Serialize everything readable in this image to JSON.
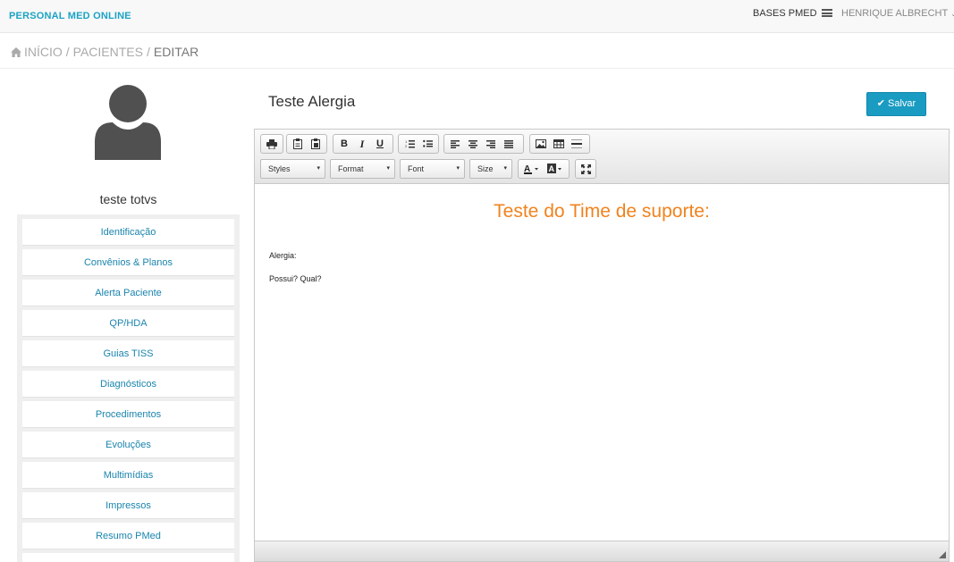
{
  "app": {
    "brand": "PERSONAL MED ONLINE"
  },
  "topbar": {
    "bases_label": "BASES PMED",
    "user_name": "HENRIQUE ALBRECHT",
    "user_caret": "⌄"
  },
  "breadcrumb": {
    "items": [
      "INÍCIO",
      "PACIENTES"
    ],
    "current": "EDITAR",
    "separator": "/"
  },
  "patient": {
    "name": "teste totvs"
  },
  "sidebar": {
    "items": [
      {
        "label": "Identificação"
      },
      {
        "label": "Convênios & Planos"
      },
      {
        "label": "Alerta Paciente"
      },
      {
        "label": "QP/HDA"
      },
      {
        "label": "Guias TISS"
      },
      {
        "label": "Diagnósticos"
      },
      {
        "label": "Procedimentos"
      },
      {
        "label": "Evoluções"
      },
      {
        "label": "Multimídias"
      },
      {
        "label": "Impressos"
      },
      {
        "label": "Resumo PMed"
      }
    ]
  },
  "document": {
    "title": "Teste Alergia",
    "save_label": "Salvar"
  },
  "editor": {
    "toolbar": {
      "bold": "B",
      "italic": "I",
      "underline": "U",
      "styles": "Styles",
      "format": "Format",
      "font": "Font",
      "size": "Size",
      "combo_arrow": "▾"
    },
    "content": {
      "heading": "Teste do Time de suporte:",
      "line1": "Alergia:",
      "line2": "Possui? Qual?"
    }
  },
  "colors": {
    "brand": "#1ba3c4",
    "accent": "#1a9bc2",
    "link": "#1a84ad",
    "heading": "#f0831e"
  }
}
